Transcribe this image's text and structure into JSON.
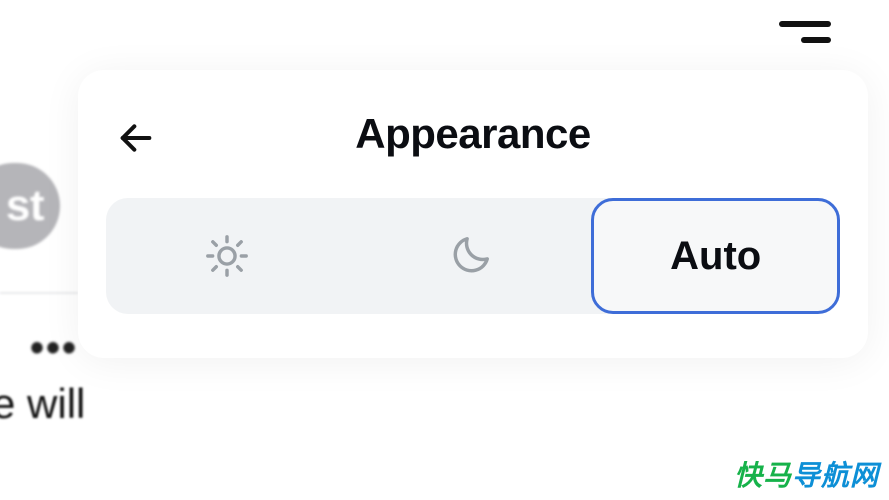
{
  "menu": {
    "name": "menu"
  },
  "background": {
    "post_button_fragment": "st",
    "more_dots": "•••",
    "truncated_text": "e will"
  },
  "modal": {
    "title": "Appearance",
    "options": {
      "light": {
        "icon": "sun-icon"
      },
      "dark": {
        "icon": "moon-icon"
      },
      "auto": {
        "label": "Auto",
        "selected": true
      }
    }
  },
  "watermark": {
    "part1": "快马",
    "part2": "导航网"
  },
  "colors": {
    "accent_border": "#3e6dd8",
    "segmented_bg": "#f1f3f5",
    "icon_gray": "#9aa0a6"
  }
}
